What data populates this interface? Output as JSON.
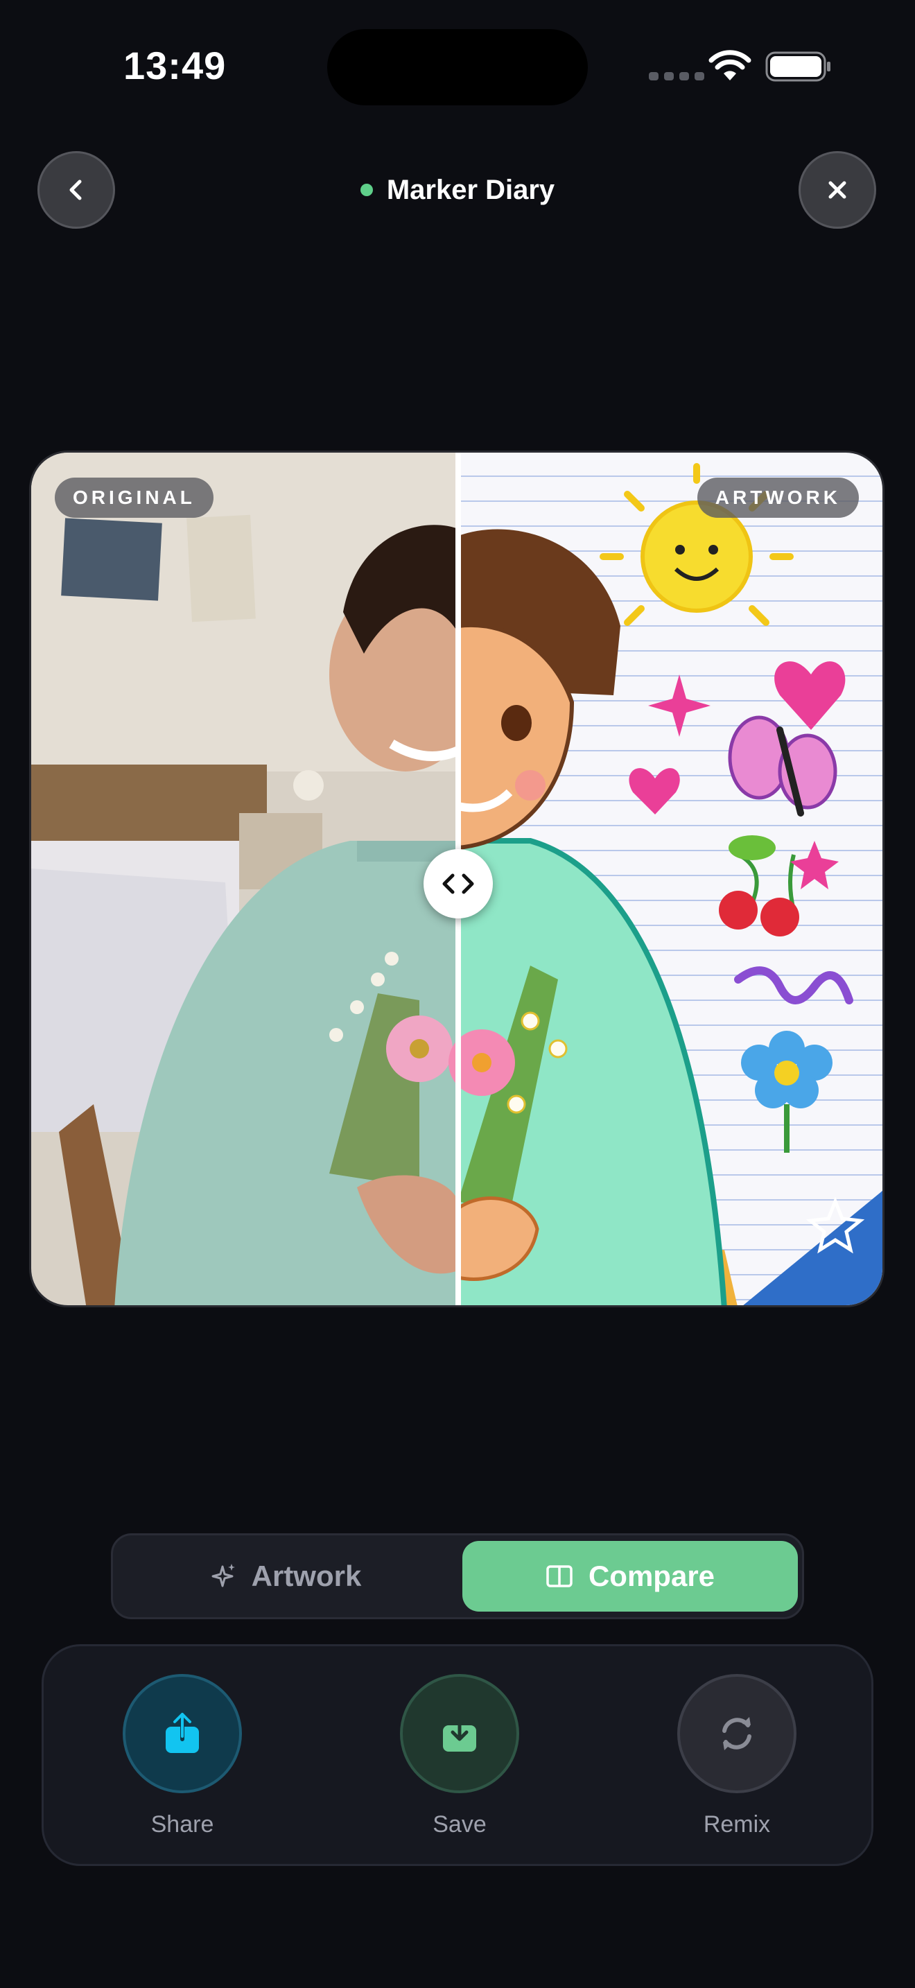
{
  "status_bar": {
    "time": "13:49"
  },
  "header": {
    "title": "Marker Diary",
    "status_dot_color": "#5fcf8a",
    "back_icon": "chevron-left-icon",
    "close_icon": "close-icon"
  },
  "compare": {
    "left_label": "ORIGINAL",
    "right_label": "ARTWORK",
    "slider_position": 0.5,
    "handle_icon": "code-arrows-icon"
  },
  "view_toggle": {
    "options": [
      {
        "label": "Artwork",
        "icon": "sparkle-icon",
        "selected": false
      },
      {
        "label": "Compare",
        "icon": "split-view-icon",
        "selected": true
      }
    ],
    "accent_color": "#6ccb91"
  },
  "actions": [
    {
      "label": "Share",
      "icon": "share-icon",
      "color": "#12c4f0"
    },
    {
      "label": "Save",
      "icon": "download-icon",
      "color": "#6ccb91"
    },
    {
      "label": "Remix",
      "icon": "refresh-icon",
      "color": "#8a8c96"
    }
  ]
}
